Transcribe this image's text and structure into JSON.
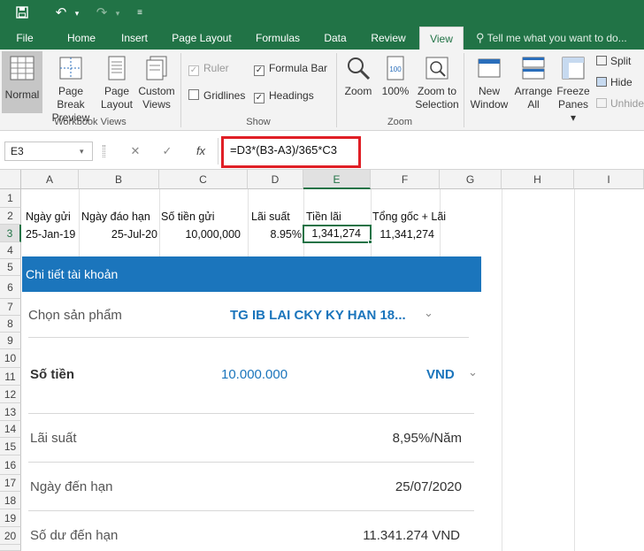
{
  "quick_access": {
    "save_icon": "save-icon",
    "undo_icon": "undo-icon",
    "redo_icon": "redo-icon",
    "customize_icon": "customize-qat-icon"
  },
  "tabs": {
    "file": "File",
    "home": "Home",
    "insert": "Insert",
    "page_layout": "Page Layout",
    "formulas": "Formulas",
    "data": "Data",
    "review": "Review",
    "view": "View",
    "tell_me": "Tell me what you want to do..."
  },
  "ribbon": {
    "workbook_views": {
      "label": "Workbook Views",
      "normal": "Normal",
      "page_break_1": "Page Break",
      "page_break_2": "Preview",
      "page_layout_1": "Page",
      "page_layout_2": "Layout",
      "custom_views_1": "Custom",
      "custom_views_2": "Views"
    },
    "show": {
      "label": "Show",
      "ruler": "Ruler",
      "formula_bar": "Formula Bar",
      "gridlines": "Gridlines",
      "headings": "Headings"
    },
    "zoom": {
      "label": "Zoom",
      "zoom": "Zoom",
      "hundred": "100%",
      "zoom_to_1": "Zoom to",
      "zoom_to_2": "Selection"
    },
    "window": {
      "new_window_1": "New",
      "new_window_2": "Window",
      "arrange_1": "Arrange",
      "arrange_2": "All",
      "freeze_1": "Freeze",
      "freeze_2": "Panes",
      "split": "Split",
      "hide": "Hide",
      "unhide": "Unhide"
    }
  },
  "formula_bar": {
    "name_box": "E3",
    "cancel": "✕",
    "enter": "✓",
    "fx": "fx",
    "formula": "=D3*(B3-A3)/365*C3"
  },
  "grid": {
    "columns": [
      "A",
      "B",
      "C",
      "D",
      "E",
      "F",
      "G",
      "H",
      "I"
    ],
    "rows": [
      "1",
      "2",
      "3",
      "4",
      "5",
      "6",
      "7",
      "8",
      "9",
      "10",
      "11",
      "12",
      "13",
      "14",
      "15",
      "16",
      "17",
      "18",
      "19",
      "20"
    ],
    "headers": {
      "a": "Ngày gửi",
      "b": "Ngày đáo hạn",
      "c": "Số tiền gửi",
      "d": "Lãi suất",
      "e": "Tiền lãi",
      "f": "Tổng gốc + Lãi"
    },
    "row3": {
      "a": "25-Jan-19",
      "b": "25-Jul-20",
      "c": "10,000,000",
      "d": "8.95%",
      "e": "1,341,274",
      "f": "11,341,274"
    }
  },
  "panel": {
    "title": "Chi tiết tài khoản",
    "product_label": "Chọn sản phẩm",
    "product_value": "TG IB LAI CKY KY HAN 18...",
    "amount_label": "Số tiền",
    "amount_value": "10.000.000",
    "currency": "VND",
    "rate_label": "Lãi suất",
    "rate_value": "8,95%/Năm",
    "maturity_label": "Ngày đến hạn",
    "maturity_value": "25/07/2020",
    "balance_label": "Số dư đến hạn",
    "balance_value": "11.341.274 VND"
  },
  "colors": {
    "excel_green": "#217346",
    "panel_blue": "#1b75bc",
    "highlight_red": "#e01f26"
  }
}
